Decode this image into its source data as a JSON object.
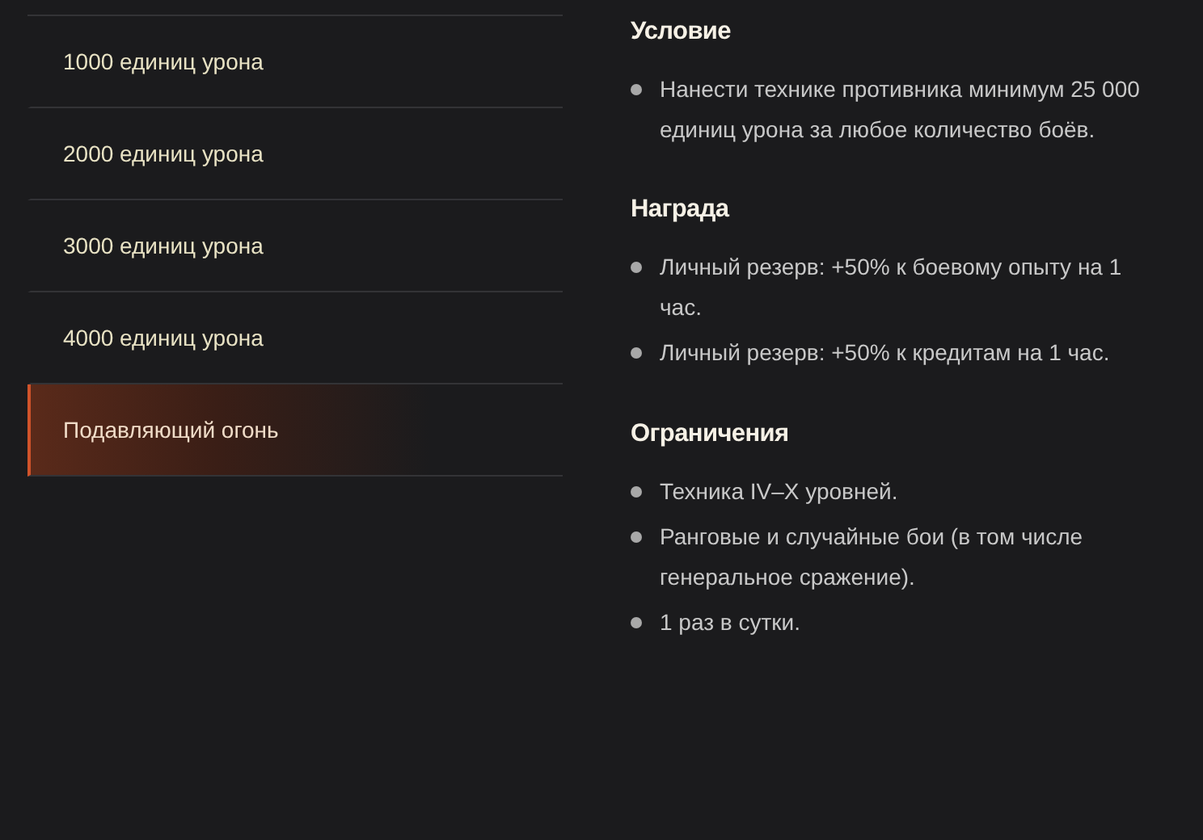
{
  "menu": [
    {
      "label": "1000 единиц урона",
      "selected": false
    },
    {
      "label": "2000 единиц урона",
      "selected": false
    },
    {
      "label": "3000 единиц урона",
      "selected": false
    },
    {
      "label": "4000 единиц урона",
      "selected": false
    },
    {
      "label": "Подавляющий огонь",
      "selected": true
    }
  ],
  "sections": [
    {
      "title": "Условие",
      "items": [
        "Нанести технике противника минимум 25 000 единиц урона за любое количество боёв."
      ]
    },
    {
      "title": "Награда",
      "items": [
        "Личный резерв: +50% к боевому опыту на 1 час.",
        "Личный резерв: +50% к кредитам на 1 час."
      ]
    },
    {
      "title": "Ограничения",
      "items": [
        "Техника IV–X уровней.",
        "Ранговые и случайные бои (в том числе генеральное сражение).",
        "1 раз в сутки."
      ]
    }
  ]
}
